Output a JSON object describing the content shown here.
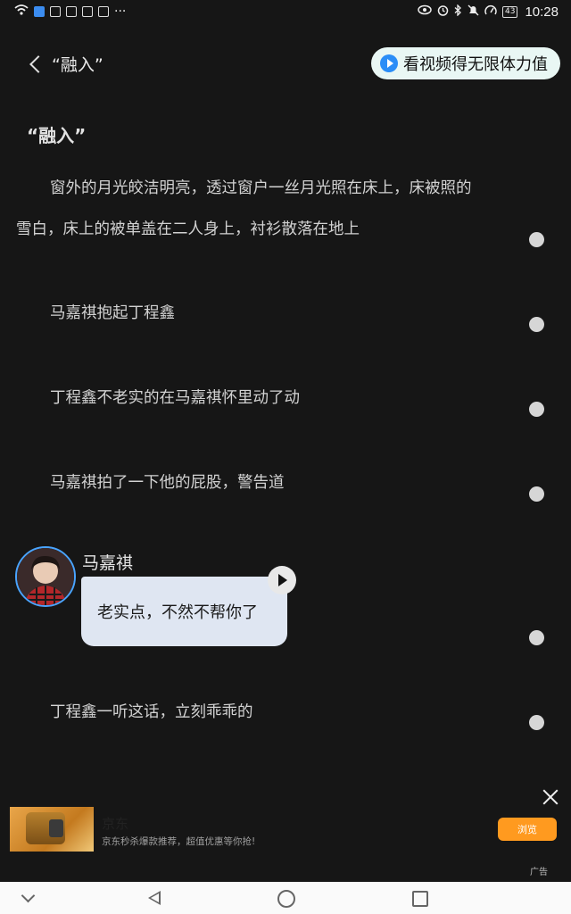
{
  "status_bar": {
    "time": "10:28",
    "battery": "43",
    "left_icons": [
      "wifi-icon",
      "message-icon",
      "app-icon",
      "shield-icon",
      "app-icon",
      "app-icon",
      "more-icon"
    ],
    "right_icons": [
      "eye-icon",
      "alarm-icon",
      "bluetooth-icon",
      "mute-icon",
      "speed-icon",
      "battery-icon"
    ]
  },
  "header": {
    "back_label": "“融入”",
    "video_button_label": "看视频得无限体力值"
  },
  "story": {
    "title": "“融入”",
    "paragraph_1_line_1": "窗外的月光皎洁明亮，透过窗户一丝月光照在床上，床被照的",
    "paragraph_1_line_2": "雪白，床上的被单盖在二人身上，衬衫散落在地上",
    "line_2": "马嘉祺抱起丁程鑫",
    "line_3": "丁程鑫不老实的在马嘉祺怀里动了动",
    "line_4": "马嘉祺拍了一下他的屁股，警告道",
    "dialogue": {
      "speaker": "马嘉祺",
      "text": "老实点，不然不帮你了"
    },
    "line_5": "丁程鑫一听这话，立刻乖乖的"
  },
  "ad": {
    "brand": "京东",
    "description": "京东秒杀爆款推荐，超值优惠等你抢!",
    "button_label": "浏览",
    "label": "广告"
  },
  "colors": {
    "background": "#161616",
    "pill_bg": "#e9f7f4",
    "accent_blue": "#2a8df7",
    "bubble_bg": "#dfe6f2",
    "ad_button": "#ff9a1f"
  }
}
